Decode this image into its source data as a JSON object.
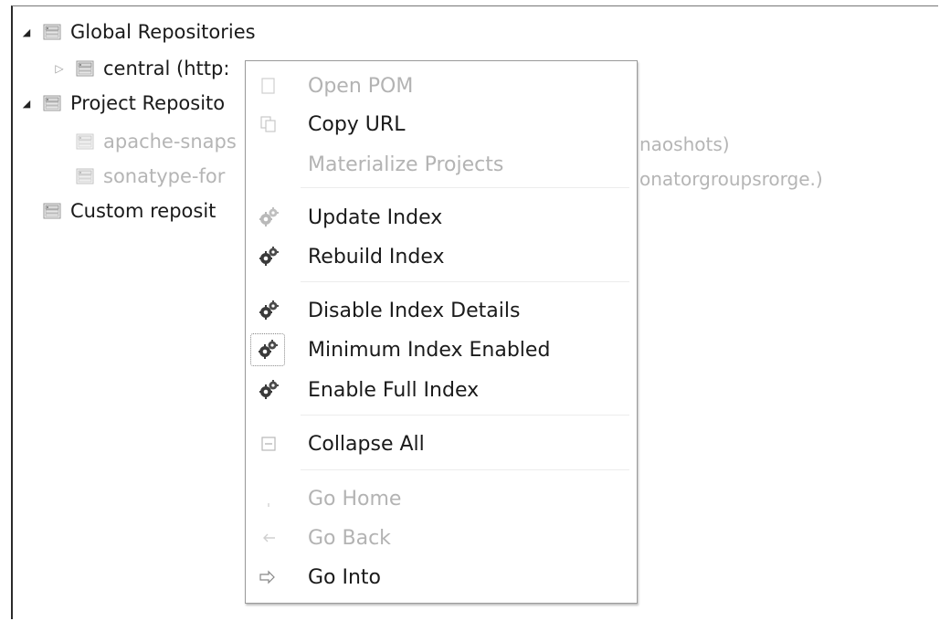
{
  "tree": {
    "items": [
      {
        "label": "Global Repositories",
        "expanded": true
      },
      {
        "label": "central (http:",
        "expanded": false
      },
      {
        "label": "Project Reposito",
        "expanded": true
      },
      {
        "label": "apache-snaps",
        "trailing": "naoshots)"
      },
      {
        "label": "sonatype-for",
        "trailing": "onatorgroupsrorge.)"
      },
      {
        "label": "Custom reposit"
      }
    ]
  },
  "context_menu": {
    "items": [
      {
        "label": "Open POM",
        "enabled": false,
        "icon": "open-pom-icon"
      },
      {
        "label": "Copy URL",
        "enabled": true,
        "icon": "copy-icon"
      },
      {
        "label": "Materialize Projects",
        "enabled": false,
        "icon": ""
      },
      {
        "label": "Update Index",
        "enabled": true,
        "icon": "update-index-icon"
      },
      {
        "label": "Rebuild Index",
        "enabled": true,
        "icon": "rebuild-index-icon"
      },
      {
        "label": "Disable Index Details",
        "enabled": true,
        "icon": "index-icon"
      },
      {
        "label": "Minimum Index Enabled",
        "enabled": true,
        "checked": true,
        "icon": "index-icon"
      },
      {
        "label": "Enable Full Index",
        "enabled": true,
        "icon": "index-icon"
      },
      {
        "label": "Collapse All",
        "enabled": true,
        "icon": "collapse-all-icon"
      },
      {
        "label": "Go Home",
        "enabled": false,
        "icon": "home-icon"
      },
      {
        "label": "Go Back",
        "enabled": false,
        "icon": "back-arrow-icon"
      },
      {
        "label": "Go Into",
        "enabled": true,
        "icon": "go-into-icon"
      }
    ]
  }
}
